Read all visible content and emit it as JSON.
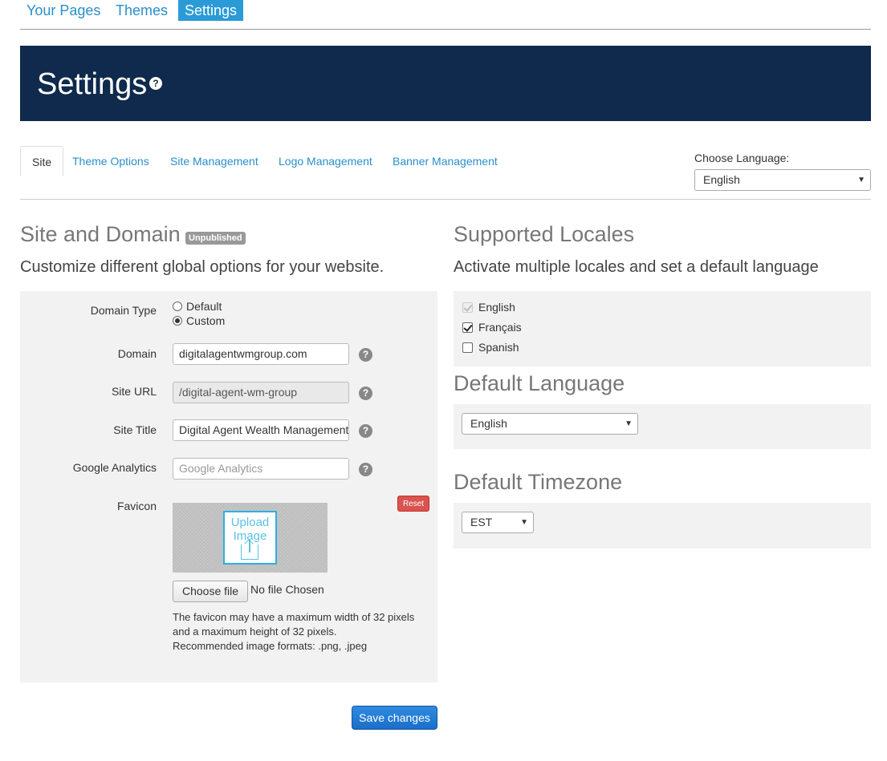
{
  "topnav": {
    "items": [
      "Your Pages",
      "Themes",
      "Settings"
    ]
  },
  "banner": {
    "title": "Settings",
    "help_icon": "?"
  },
  "tabs": {
    "items": [
      "Site",
      "Theme Options",
      "Site Management",
      "Logo Management",
      "Banner Management"
    ],
    "language_label": "Choose Language:",
    "language_value": "English"
  },
  "site": {
    "heading": "Site and Domain",
    "badge": "Unpublished",
    "subheading": "Customize different global options for your website.",
    "domain_type_label": "Domain Type",
    "domain_type_options": [
      "Default",
      "Custom"
    ],
    "domain_type_selected": "Custom",
    "domain_label": "Domain",
    "domain_value": "digitalagentwmgroup.com",
    "site_url_label": "Site URL",
    "site_url_value": "/digital-agent-wm-group",
    "site_title_label": "Site Title",
    "site_title_value": "Digital Agent Wealth Management",
    "analytics_label": "Google Analytics",
    "analytics_placeholder": "Google Analytics",
    "favicon_label": "Favicon",
    "upload_text_1": "Upload",
    "upload_text_2": "Image",
    "reset_label": "Reset",
    "choose_file_label": "Choose file",
    "file_status": "No file Chosen",
    "help_line_1": "The favicon may have a maximum width of 32 pixels",
    "help_line_2": "and a maximum height of 32 pixels.",
    "help_line_3": "Recommended image formats: .png, .jpeg",
    "save_label": "Save changes"
  },
  "locales": {
    "heading": "Supported Locales",
    "subheading": "Activate multiple locales and set a default language",
    "items": [
      {
        "label": "English",
        "checked": true,
        "disabled": true
      },
      {
        "label": "Français",
        "checked": true,
        "disabled": false
      },
      {
        "label": "Spanish",
        "checked": false,
        "disabled": false
      }
    ],
    "default_language_heading": "Default Language",
    "default_language_value": "English",
    "default_timezone_heading": "Default Timezone",
    "default_timezone_value": "EST"
  },
  "colors": {
    "banner": "#0f2a4c",
    "link": "#2a8fc9",
    "active_tab": "#2a9bd6",
    "save": "#1a6fc9",
    "reset": "#d9534f"
  }
}
